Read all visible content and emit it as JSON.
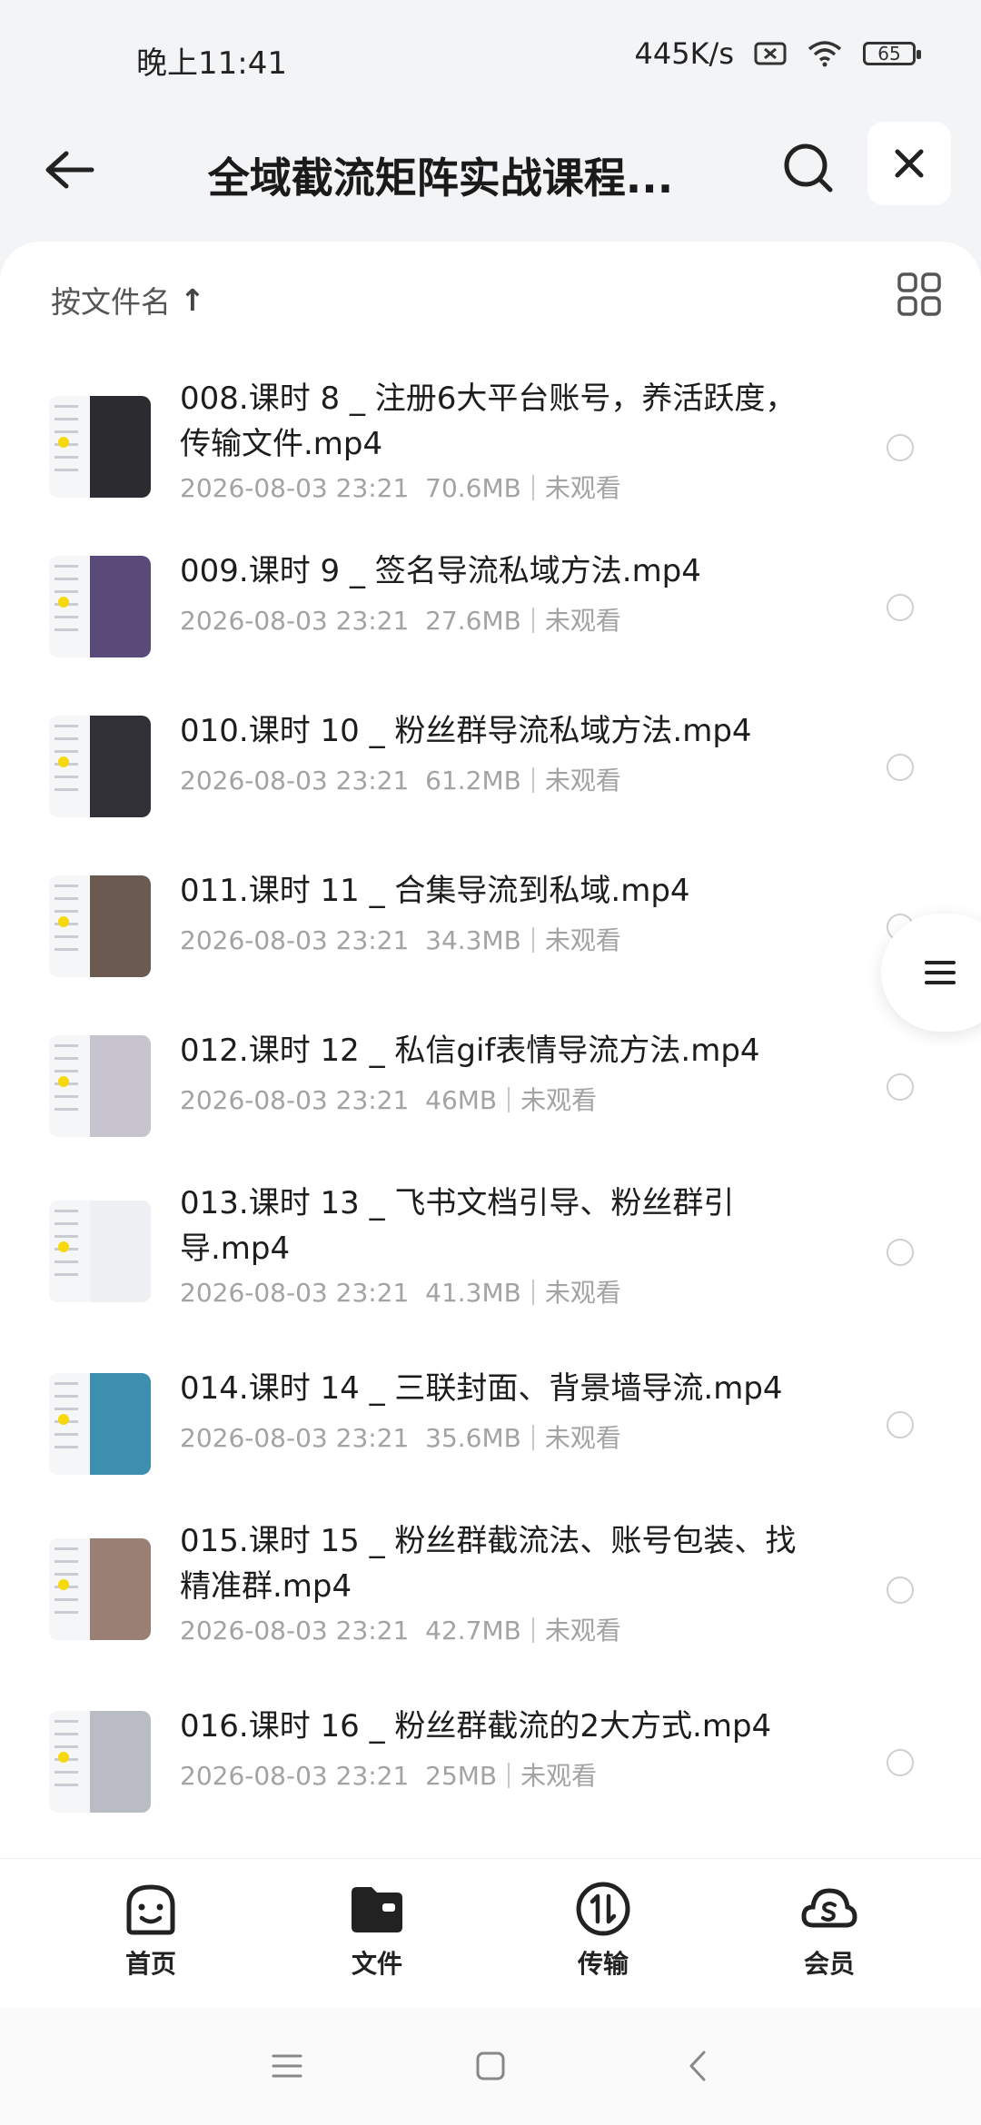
{
  "status": {
    "time": "晚上11:41",
    "speed": "445K/s",
    "battery": "65"
  },
  "header": {
    "title": "全域截流矩阵实战课程..."
  },
  "sort": {
    "label": "按文件名",
    "arrow": "↑"
  },
  "files": [
    {
      "name": "008.课时 8 _ 注册6大平台账号，养活跃度，传输文件.mp4",
      "date": "2026-08-03 23:21",
      "size": "70.6MB",
      "status": "未观看"
    },
    {
      "name": "009.课时 9 _ 签名导流私域方法.mp4",
      "date": "2026-08-03 23:21",
      "size": "27.6MB",
      "status": "未观看"
    },
    {
      "name": "010.课时 10 _ 粉丝群导流私域方法.mp4",
      "date": "2026-08-03 23:21",
      "size": "61.2MB",
      "status": "未观看"
    },
    {
      "name": "011.课时 11 _ 合集导流到私域.mp4",
      "date": "2026-08-03 23:21",
      "size": "34.3MB",
      "status": "未观看"
    },
    {
      "name": "012.课时 12 _ 私信gif表情导流方法.mp4",
      "date": "2026-08-03 23:21",
      "size": "46MB",
      "status": "未观看"
    },
    {
      "name": "013.课时 13 _ 飞书文档引导、粉丝群引导.mp4",
      "date": "2026-08-03 23:21",
      "size": "41.3MB",
      "status": "未观看"
    },
    {
      "name": "014.课时 14 _ 三联封面、背景墙导流.mp4",
      "date": "2026-08-03 23:21",
      "size": "35.6MB",
      "status": "未观看"
    },
    {
      "name": "015.课时 15 _ 粉丝群截流法、账号包装、找精准群.mp4",
      "date": "2026-08-03 23:21",
      "size": "42.7MB",
      "status": "未观看"
    },
    {
      "name": "016.课时 16 _ 粉丝群截流的2大方式.mp4",
      "date": "2026-08-03 23:21",
      "size": "25MB",
      "status": "未观看"
    }
  ],
  "tabs": [
    {
      "label": "首页",
      "icon": "smile-house-icon"
    },
    {
      "label": "文件",
      "icon": "folder-icon"
    },
    {
      "label": "传输",
      "icon": "transfer-icon"
    },
    {
      "label": "会员",
      "icon": "cloud-vip-icon"
    }
  ]
}
